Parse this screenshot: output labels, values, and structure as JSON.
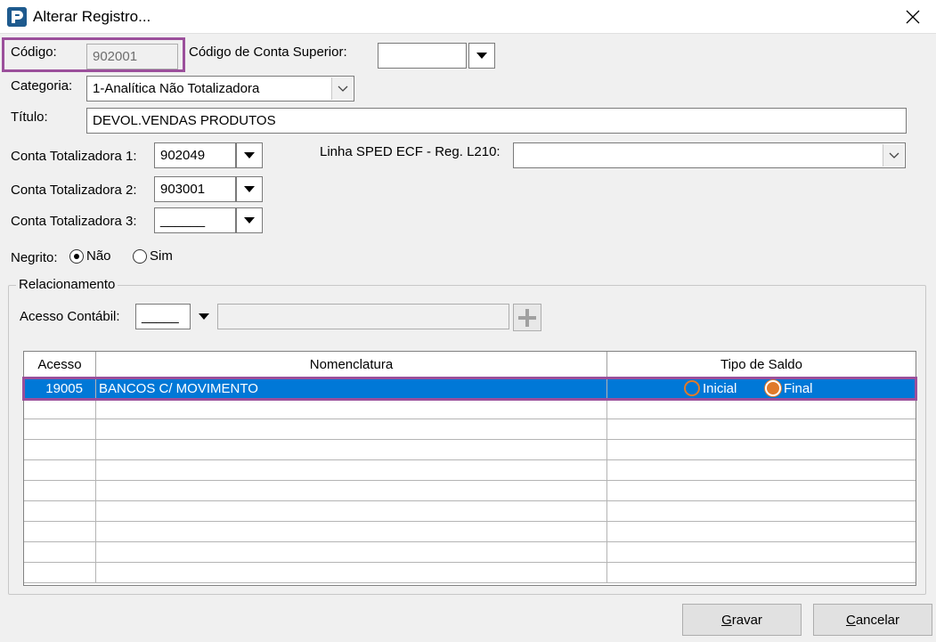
{
  "window": {
    "title": "Alterar Registro..."
  },
  "form": {
    "codigo_label": "Código:",
    "codigo_value": "902001",
    "conta_superior_label": "Código de Conta Superior:",
    "conta_superior_value": "",
    "categoria_label": "Categoria:",
    "categoria_value": "1-Analítica Não Totalizadora",
    "titulo_label": "Título:",
    "titulo_value": "DEVOL.VENDAS PRODUTOS",
    "conta_tot1_label": "Conta Totalizadora 1:",
    "conta_tot1_value": "902049",
    "conta_tot2_label": "Conta Totalizadora 2:",
    "conta_tot2_value": "903001",
    "conta_tot3_label": "Conta Totalizadora 3:",
    "conta_tot3_value": "______",
    "sped_label": "Linha SPED ECF - Reg. L210:",
    "sped_value": "",
    "negrito_label": "Negrito:",
    "negrito_nao": "Não",
    "negrito_sim": "Sim",
    "negrito_selected": "Não"
  },
  "relacionamento": {
    "legend": "Relacionamento",
    "acesso_label": "Acesso Contábil:",
    "acesso_value": "_____",
    "acesso_desc": "",
    "columns": [
      "Acesso",
      "Nomenclatura",
      "Tipo de Saldo"
    ],
    "rows": [
      {
        "acesso": "19005",
        "nomenclatura": "BANCOS C/ MOVIMENTO",
        "saldo_inicial": "Inicial",
        "saldo_final": "Final",
        "selected_saldo": "Final"
      }
    ]
  },
  "buttons": {
    "gravar": "Gravar",
    "cancelar": "Cancelar"
  },
  "colors": {
    "highlight": "#9b4f9b",
    "selection": "#0078d7",
    "radio_accent": "#e07a2a"
  }
}
